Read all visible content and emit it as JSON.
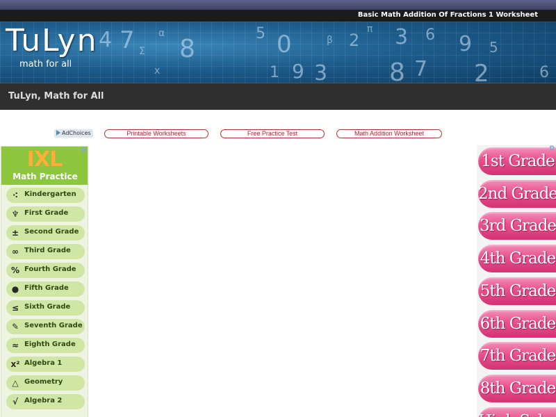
{
  "header": {
    "page_title": "Basic Math Addition Of Fractions 1 Worksheet",
    "logo_text": "TuLyn",
    "logo_tagline": "math for all",
    "subtitle": "TuLyn, Math for All",
    "banner_symbols": [
      "4",
      "7",
      "α",
      "8",
      "5",
      "0",
      "β",
      "2",
      "π",
      "3",
      "6",
      "9",
      "5",
      "Σ",
      "1",
      "9",
      "3",
      "8",
      "7",
      "x",
      "2",
      "6"
    ]
  },
  "ads": {
    "adchoices_label": "AdChoices",
    "ad_flag": "D"
  },
  "nav_links": [
    {
      "label": "Printable Worksheets"
    },
    {
      "label": "Free Practice Test"
    },
    {
      "label": "Math Addition Worksheet"
    }
  ],
  "left_ad": {
    "brand": "IXL",
    "subtitle": "Math Practice",
    "items": [
      {
        "label": "Kindergarten",
        "icon": "dots-icon",
        "glyph": "⁖"
      },
      {
        "label": "First Grade",
        "icon": "pencil-cup-icon",
        "glyph": "♆"
      },
      {
        "label": "Second Grade",
        "icon": "plus-minus-icon",
        "glyph": "±"
      },
      {
        "label": "Third Grade",
        "icon": "infinity-icon",
        "glyph": "∞"
      },
      {
        "label": "Fourth Grade",
        "icon": "percent-icon",
        "glyph": "%"
      },
      {
        "label": "Fifth Grade",
        "icon": "apple-icon",
        "glyph": "●"
      },
      {
        "label": "Sixth Grade",
        "icon": "less-equal-icon",
        "glyph": "≤"
      },
      {
        "label": "Seventh Grade",
        "icon": "pencil-icon",
        "glyph": "✎"
      },
      {
        "label": "Eighth Grade",
        "icon": "approx-icon",
        "glyph": "≈"
      },
      {
        "label": "Algebra 1",
        "icon": "x-squared-icon",
        "glyph": "x²"
      },
      {
        "label": "Geometry",
        "icon": "triangle-icon",
        "glyph": "△"
      },
      {
        "label": "Algebra 2",
        "icon": "square-root-icon",
        "glyph": "√"
      }
    ]
  },
  "right_ad": {
    "grades": [
      {
        "label": "1st Grade"
      },
      {
        "label": "2nd Grade"
      },
      {
        "label": "3rd Grade"
      },
      {
        "label": "4th Grade"
      },
      {
        "label": "5th Grade"
      },
      {
        "label": "6th Grade"
      },
      {
        "label": "7th Grade"
      },
      {
        "label": "8th Grade"
      },
      {
        "label": "High School"
      }
    ]
  },
  "colors": {
    "title_bar": "#1b1b1b",
    "banner": "#1d5c8c",
    "ixl_green": "#8dc63f",
    "ixl_orange": "#fbb03b",
    "grade_pink": "#e8508e",
    "link_red": "#b21c2b"
  }
}
